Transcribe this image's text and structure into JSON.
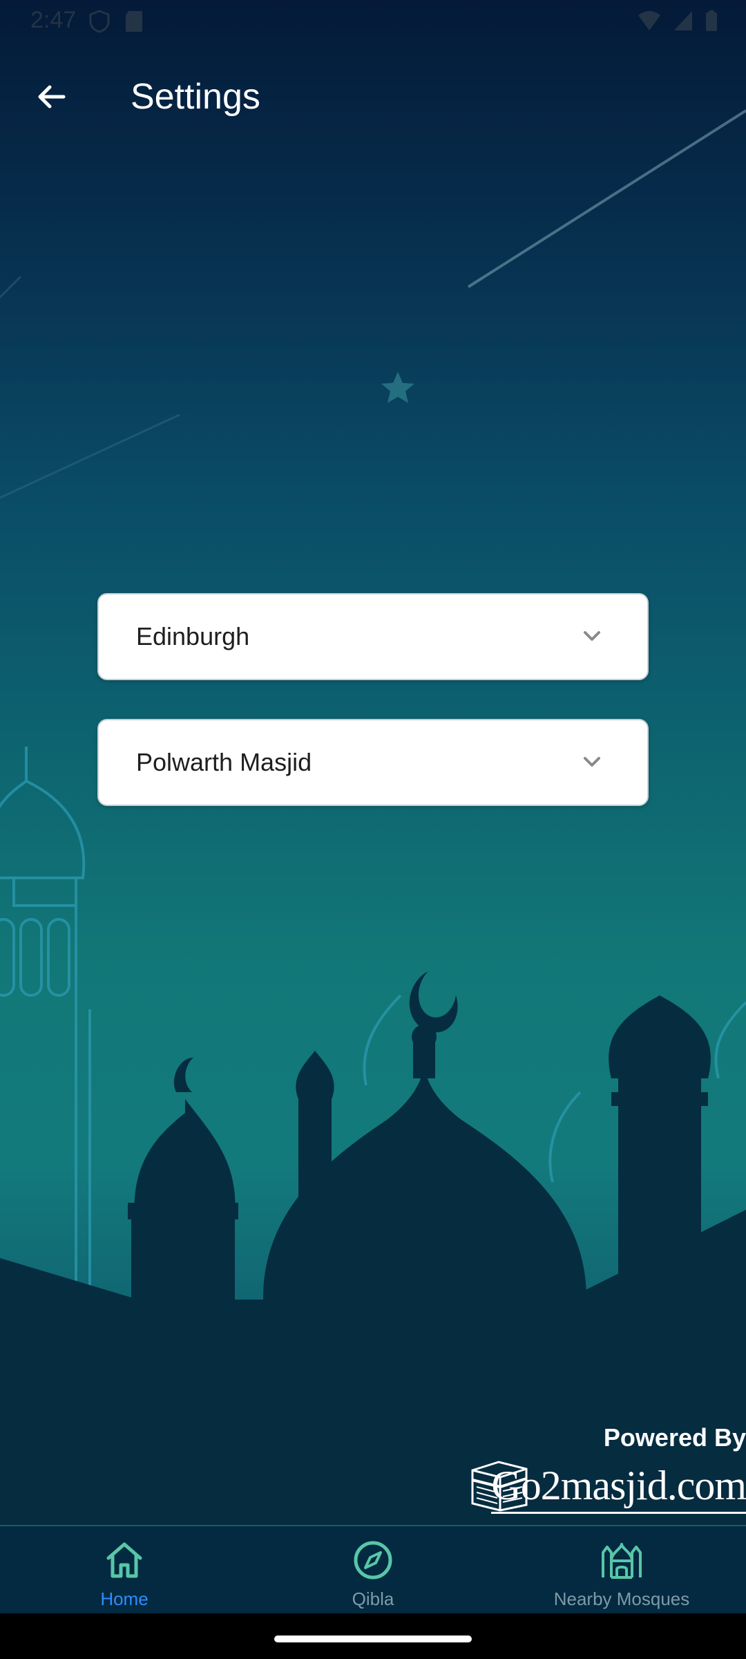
{
  "status_bar": {
    "time": "2:47",
    "icons_left": [
      "shield-icon",
      "sd-card-icon"
    ],
    "icons_right": [
      "wifi-icon",
      "signal-icon",
      "battery-icon"
    ]
  },
  "app_bar": {
    "back_icon": "arrow-left-icon",
    "title": "Settings"
  },
  "form": {
    "city_dropdown": {
      "selected": "Edinburgh"
    },
    "mosque_dropdown": {
      "selected": "Polwarth Masjid"
    }
  },
  "branding": {
    "powered_by": "Powered By",
    "logo_text": "Go2masjid.com"
  },
  "bottom_nav": {
    "items": [
      {
        "label": "Home",
        "icon": "home-icon",
        "active": true
      },
      {
        "label": "Qibla",
        "icon": "compass-icon",
        "active": false
      },
      {
        "label": "Nearby Mosques",
        "icon": "mosque-icon",
        "active": false
      }
    ]
  },
  "colors": {
    "accent": "#2f8cff",
    "icon_teal": "#58c6a8",
    "nav_background": "#032a41"
  }
}
